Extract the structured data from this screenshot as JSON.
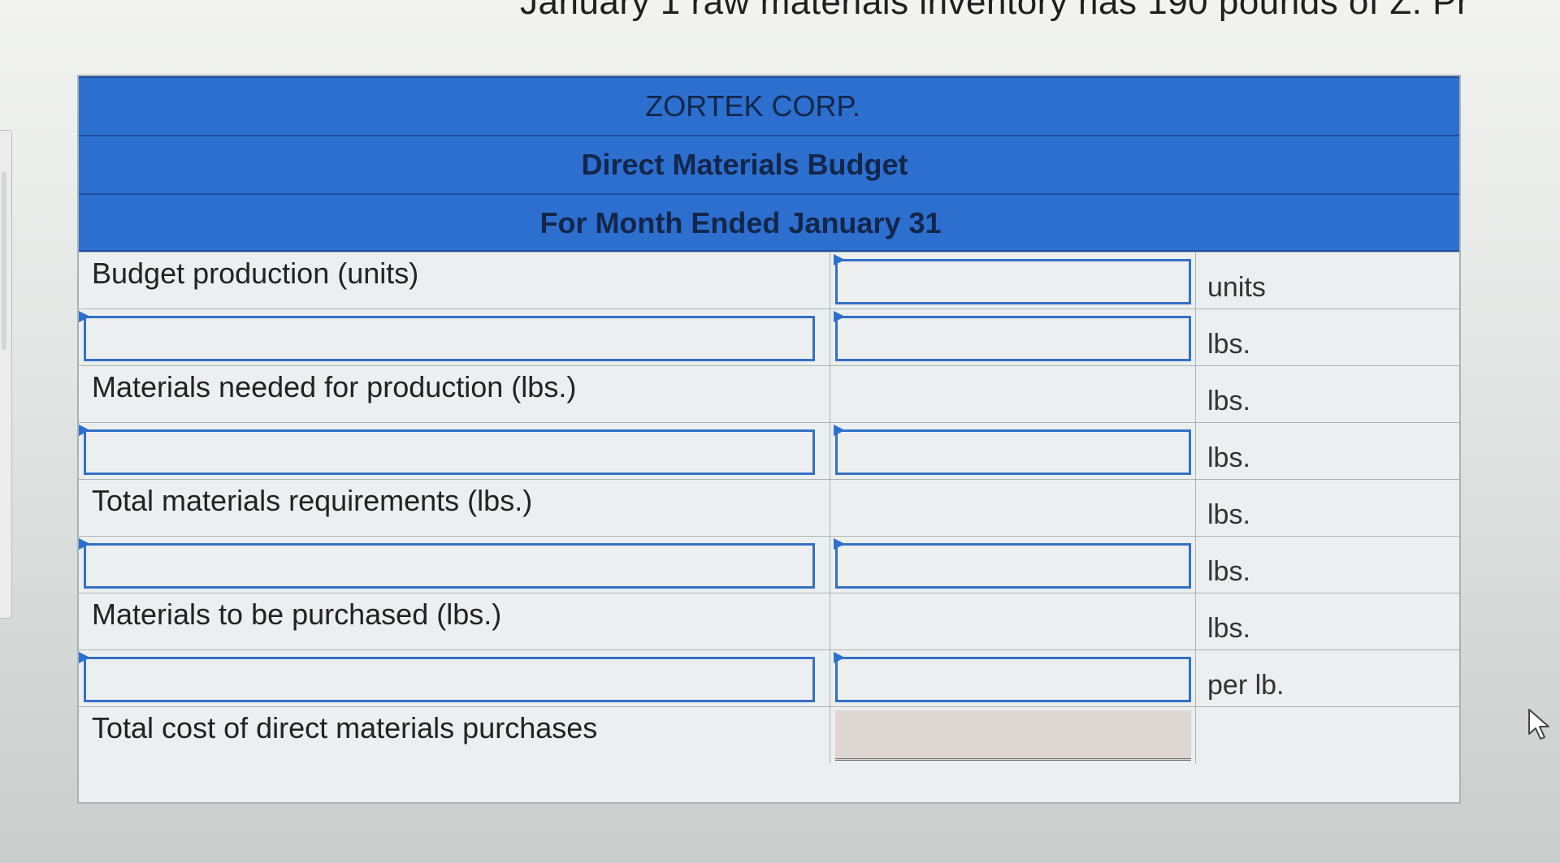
{
  "instruction": "January 1 raw materials inventory has 190 pounds of Z. Pr",
  "header": {
    "company": "ZORTEK CORP.",
    "title": "Direct Materials Budget",
    "period": "For Month Ended January 31"
  },
  "rows": [
    {
      "label": "Budget production (units)",
      "unit": "units"
    },
    {
      "label": "",
      "unit": "lbs."
    },
    {
      "label": "Materials needed for production (lbs.)",
      "unit": "lbs."
    },
    {
      "label": "",
      "unit": "lbs."
    },
    {
      "label": "Total materials requirements (lbs.)",
      "unit": "lbs."
    },
    {
      "label": "",
      "unit": "lbs."
    },
    {
      "label": "Materials to be purchased (lbs.)",
      "unit": "lbs."
    },
    {
      "label": "",
      "unit": "per lb."
    },
    {
      "label": "Total cost of direct materials purchases",
      "unit": ""
    }
  ],
  "colors": {
    "header_blue": "#2d6fcf",
    "input_border": "#3470c7",
    "total_cell": "#ddd6d3"
  },
  "icons": [
    "row-marker-icon",
    "mouse-pointer-icon"
  ]
}
